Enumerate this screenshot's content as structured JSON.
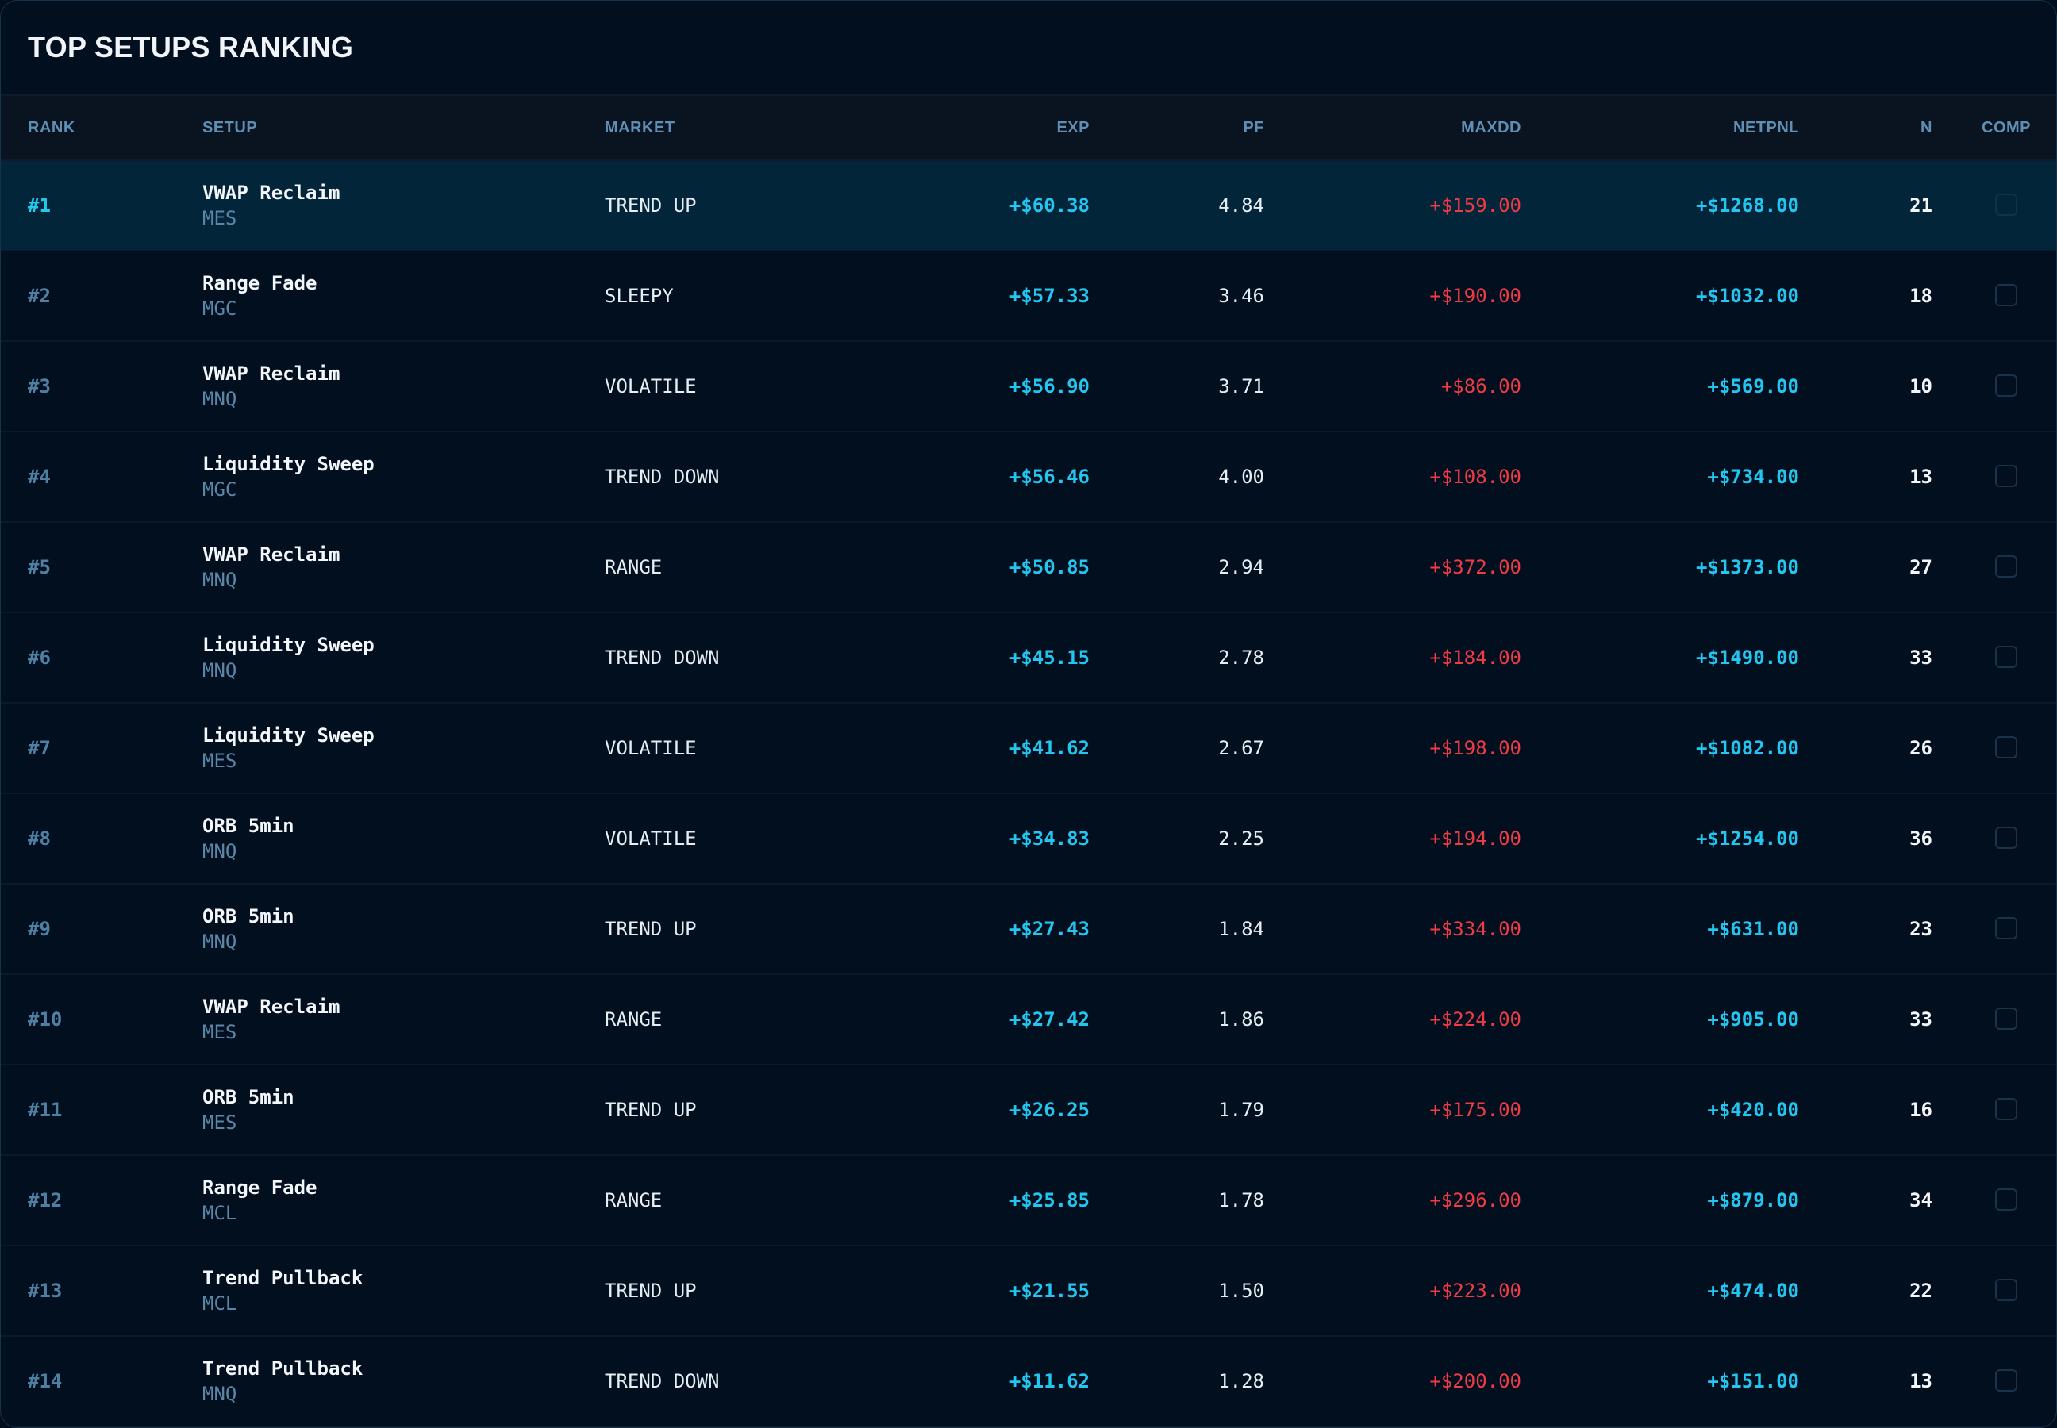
{
  "title": "TOP SETUPS RANKING",
  "columns": {
    "rank": "RANK",
    "setup": "SETUP",
    "market": "MARKET",
    "exp": "EXP",
    "pf": "PF",
    "maxdd": "MAXDD",
    "netpnl": "NETPNL",
    "n": "N",
    "comp": "COMP"
  },
  "rows": [
    {
      "rank": "#1",
      "setup": "VWAP Reclaim",
      "symbol": "MES",
      "market": "TREND UP",
      "exp": "+$60.38",
      "pf": "4.84",
      "maxdd": "+$159.00",
      "netpnl": "+$1268.00",
      "n": "21",
      "comp": false,
      "highlighted": true
    },
    {
      "rank": "#2",
      "setup": "Range Fade",
      "symbol": "MGC",
      "market": "SLEEPY",
      "exp": "+$57.33",
      "pf": "3.46",
      "maxdd": "+$190.00",
      "netpnl": "+$1032.00",
      "n": "18",
      "comp": false
    },
    {
      "rank": "#3",
      "setup": "VWAP Reclaim",
      "symbol": "MNQ",
      "market": "VOLATILE",
      "exp": "+$56.90",
      "pf": "3.71",
      "maxdd": "+$86.00",
      "netpnl": "+$569.00",
      "n": "10",
      "comp": false
    },
    {
      "rank": "#4",
      "setup": "Liquidity Sweep",
      "symbol": "MGC",
      "market": "TREND DOWN",
      "exp": "+$56.46",
      "pf": "4.00",
      "maxdd": "+$108.00",
      "netpnl": "+$734.00",
      "n": "13",
      "comp": false
    },
    {
      "rank": "#5",
      "setup": "VWAP Reclaim",
      "symbol": "MNQ",
      "market": "RANGE",
      "exp": "+$50.85",
      "pf": "2.94",
      "maxdd": "+$372.00",
      "netpnl": "+$1373.00",
      "n": "27",
      "comp": false
    },
    {
      "rank": "#6",
      "setup": "Liquidity Sweep",
      "symbol": "MNQ",
      "market": "TREND DOWN",
      "exp": "+$45.15",
      "pf": "2.78",
      "maxdd": "+$184.00",
      "netpnl": "+$1490.00",
      "n": "33",
      "comp": false
    },
    {
      "rank": "#7",
      "setup": "Liquidity Sweep",
      "symbol": "MES",
      "market": "VOLATILE",
      "exp": "+$41.62",
      "pf": "2.67",
      "maxdd": "+$198.00",
      "netpnl": "+$1082.00",
      "n": "26",
      "comp": false
    },
    {
      "rank": "#8",
      "setup": "ORB 5min",
      "symbol": "MNQ",
      "market": "VOLATILE",
      "exp": "+$34.83",
      "pf": "2.25",
      "maxdd": "+$194.00",
      "netpnl": "+$1254.00",
      "n": "36",
      "comp": false
    },
    {
      "rank": "#9",
      "setup": "ORB 5min",
      "symbol": "MNQ",
      "market": "TREND UP",
      "exp": "+$27.43",
      "pf": "1.84",
      "maxdd": "+$334.00",
      "netpnl": "+$631.00",
      "n": "23",
      "comp": false
    },
    {
      "rank": "#10",
      "setup": "VWAP Reclaim",
      "symbol": "MES",
      "market": "RANGE",
      "exp": "+$27.42",
      "pf": "1.86",
      "maxdd": "+$224.00",
      "netpnl": "+$905.00",
      "n": "33",
      "comp": false
    },
    {
      "rank": "#11",
      "setup": "ORB 5min",
      "symbol": "MES",
      "market": "TREND UP",
      "exp": "+$26.25",
      "pf": "1.79",
      "maxdd": "+$175.00",
      "netpnl": "+$420.00",
      "n": "16",
      "comp": false
    },
    {
      "rank": "#12",
      "setup": "Range Fade",
      "symbol": "MCL",
      "market": "RANGE",
      "exp": "+$25.85",
      "pf": "1.78",
      "maxdd": "+$296.00",
      "netpnl": "+$879.00",
      "n": "34",
      "comp": false
    },
    {
      "rank": "#13",
      "setup": "Trend Pullback",
      "symbol": "MCL",
      "market": "TREND UP",
      "exp": "+$21.55",
      "pf": "1.50",
      "maxdd": "+$223.00",
      "netpnl": "+$474.00",
      "n": "22",
      "comp": false
    },
    {
      "rank": "#14",
      "setup": "Trend Pullback",
      "symbol": "MNQ",
      "market": "TREND DOWN",
      "exp": "+$11.62",
      "pf": "1.28",
      "maxdd": "+$200.00",
      "netpnl": "+$151.00",
      "n": "13",
      "comp": false
    }
  ],
  "colors": {
    "background": "#010f1f",
    "highlight_row": "#02253a",
    "positive": "#23c6f0",
    "negative": "#ef3b45",
    "header_text": "#5f8fb4"
  }
}
